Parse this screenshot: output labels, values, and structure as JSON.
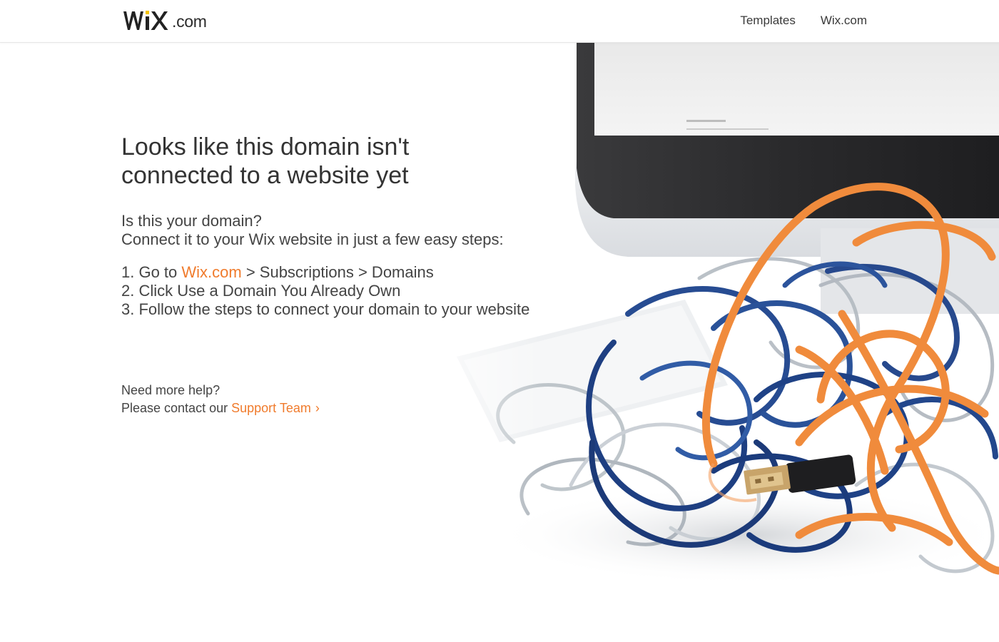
{
  "header": {
    "logo_com": ".com",
    "nav": [
      {
        "label": "Templates"
      },
      {
        "label": "Wix.com"
      }
    ]
  },
  "main": {
    "title": "Looks like this domain isn't connected to a website yet",
    "question": "Is this your domain?",
    "subtitle": "Connect it to your Wix website in just a few easy steps:",
    "steps": {
      "step1_prefix": "1. Go to ",
      "step1_link": "Wix.com",
      "step1_suffix": " > Subscriptions > Domains",
      "step2": "2. Click Use a Domain You Already Own",
      "step3": "3. Follow the steps to connect your domain to your website"
    }
  },
  "help": {
    "line1": "Need more help?",
    "line2_prefix": "Please contact our ",
    "link": "Support Team",
    "chevron": "›"
  },
  "colors": {
    "accent": "#f07b2c",
    "text": "#3b3b3b"
  },
  "icons": [
    "wix-logo",
    "chevron-right-icon"
  ],
  "image": "tangled-cables-illustration"
}
